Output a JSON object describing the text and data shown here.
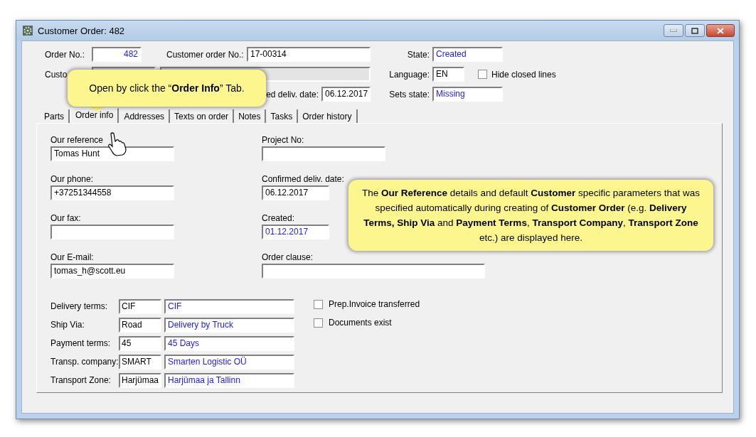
{
  "window": {
    "title": "Customer Order: 482"
  },
  "header": {
    "order_no": {
      "label": "Order No.:",
      "value": "482",
      "linked": true
    },
    "customer_order_no": {
      "label": "Customer order No.:",
      "value": "17-00314",
      "linked": false
    },
    "state": {
      "label": "State:",
      "value": "Created",
      "linked": true
    },
    "customer": {
      "label": "Custo"
    },
    "language": {
      "label": "Language:",
      "value": "EN",
      "linked": false
    },
    "hide_closed_lines": {
      "label": "Hide closed lines",
      "checked": false
    },
    "wanted_deliv_date": {
      "label": "ed deliv. date:",
      "value": "06.12.2017",
      "linked": false
    },
    "sets_state": {
      "label": "Sets state:",
      "value": "Missing",
      "linked": true
    }
  },
  "tabs": [
    {
      "label": "Parts",
      "selected": false
    },
    {
      "label": "Order info",
      "selected": true
    },
    {
      "label": "Addresses",
      "selected": false
    },
    {
      "label": "Texts on order",
      "selected": false
    },
    {
      "label": "Notes",
      "selected": false
    },
    {
      "label": "Tasks",
      "selected": false
    },
    {
      "label": "Order history",
      "selected": false
    }
  ],
  "order_info": {
    "left": [
      {
        "label": "Our reference",
        "value": "Tomas Hunt"
      },
      {
        "label": "Our phone:",
        "value": "+37251344558"
      },
      {
        "label": "Our fax:"
      },
      {
        "label": "Our E-mail:",
        "value": "tomas_h@scott.eu"
      }
    ],
    "right": [
      {
        "label": "Project No:",
        "kind": "wide"
      },
      {
        "label": "Confirmed deliv. date:",
        "value": "06.12.2017",
        "kind": "date"
      },
      {
        "label": "Created:",
        "value": "01.12.2017",
        "kind": "lookup"
      },
      {
        "label": "Order clause:",
        "kind": "long"
      }
    ],
    "terms": [
      {
        "label": "Delivery terms:",
        "code": "CIF",
        "description": "CIF"
      },
      {
        "label": "Ship Via:",
        "code": "Road",
        "description": "Delivery by Truck"
      },
      {
        "label": "Payment terms:",
        "code": "45",
        "description": "45 Days"
      },
      {
        "label": "Transp. company:",
        "code": "SMART",
        "description": "Smarten Logistic OÜ"
      },
      {
        "label": "Transport Zone:",
        "code": "Harjümaa",
        "description": "Harjümaa ja Tallinn"
      }
    ],
    "checkboxes": [
      {
        "label": "Prep.Invoice transferred",
        "checked": false
      },
      {
        "label": "Documents exist",
        "checked": false
      }
    ]
  },
  "callouts": [
    {
      "text": "Open by click the “**Order Info**” Tab."
    },
    {
      "text": "The **Our Reference** details and default **Customer** specific parameters that was specified automatically during creating of **Customer Order** (e.g. **Delivery Terms, Ship Via** and **Payment Terms**, **Transport Company**, **Transport Zone** etc.) are displayed here."
    }
  ]
}
